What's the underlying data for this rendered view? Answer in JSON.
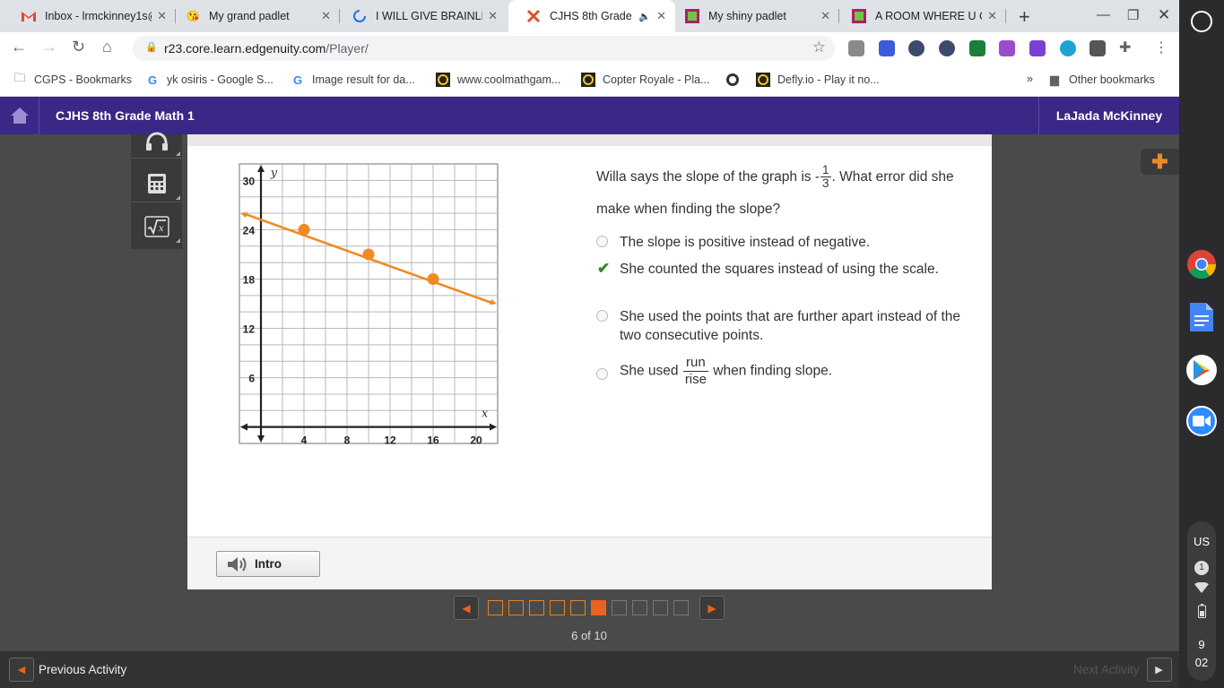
{
  "browser": {
    "tabs": [
      {
        "title": "Inbox - lrmckinney1s@",
        "icon": "gmail-icon"
      },
      {
        "title": "My grand padlet",
        "icon": "emoji-face-icon"
      },
      {
        "title": "I WILL GIVE BRAINLE",
        "icon": "loading-spinner-icon"
      },
      {
        "title": "CJHS 8th Grade",
        "icon": "edgenuity-icon"
      },
      {
        "title": "My shiny padlet",
        "icon": "padlet-icon"
      },
      {
        "title": "A ROOM WHERE U C",
        "icon": "padlet-icon"
      }
    ],
    "url_host": "r23.core.learn.edgenuity.com",
    "url_path": "/Player/",
    "bookmarks": [
      {
        "label": "CGPS - Bookmarks",
        "icon": "folder-icon"
      },
      {
        "label": "yk osiris - Google S...",
        "icon": "google-icon"
      },
      {
        "label": "Image result for da...",
        "icon": "google-icon"
      },
      {
        "label": "www.coolmathgam...",
        "icon": "coolmath-icon"
      },
      {
        "label": "Copter Royale - Pla...",
        "icon": "coolmath-icon"
      },
      {
        "label": "",
        "icon": "globe-icon"
      },
      {
        "label": "Defly.io - Play it no...",
        "icon": "coolmath-icon"
      }
    ],
    "bookmarks_overflow": "»",
    "other_bookmarks": "Other bookmarks"
  },
  "app": {
    "course": "CJHS 8th Grade Math 1",
    "user": "LaJada McKinney",
    "intro_label": "Intro",
    "question": {
      "prefix": "Willa says the slope of the graph is ",
      "neg": "-",
      "num": "1",
      "den": "3",
      "suffix": ". What error did she make when finding the slope?"
    },
    "choices": [
      {
        "text": "The slope is positive instead of negative.",
        "checked": false
      },
      {
        "text": "She counted the squares instead of using the scale.",
        "checked": true
      },
      {
        "text": "She used the points that are further apart instead of the two consecutive points.",
        "checked": false
      },
      {
        "pre": "She used ",
        "num": "run",
        "den": "rise",
        "post": " when finding slope.",
        "checked": false
      }
    ],
    "pager": {
      "count_text": "6 of 10",
      "total": 10,
      "current": 6
    },
    "prev_label": "Previous Activity",
    "next_label": "Next Activity"
  },
  "chart_data": {
    "type": "line",
    "xlabel": "x",
    "ylabel": "y",
    "xlim": [
      -2,
      22
    ],
    "ylim": [
      -2,
      32
    ],
    "x_ticks": [
      4,
      8,
      12,
      16,
      20
    ],
    "y_ticks": [
      6,
      12,
      18,
      24,
      30
    ],
    "grid": true,
    "line": {
      "x1": -2,
      "y1": 26,
      "x2": 22,
      "y2": 15,
      "color": "#f08a24"
    },
    "points": [
      {
        "x": 4,
        "y": 24
      },
      {
        "x": 10,
        "y": 21
      },
      {
        "x": 16,
        "y": 18
      }
    ]
  },
  "system": {
    "keyboard": "US",
    "notification_count": "1",
    "time_hour": "9",
    "time_min": "02"
  }
}
